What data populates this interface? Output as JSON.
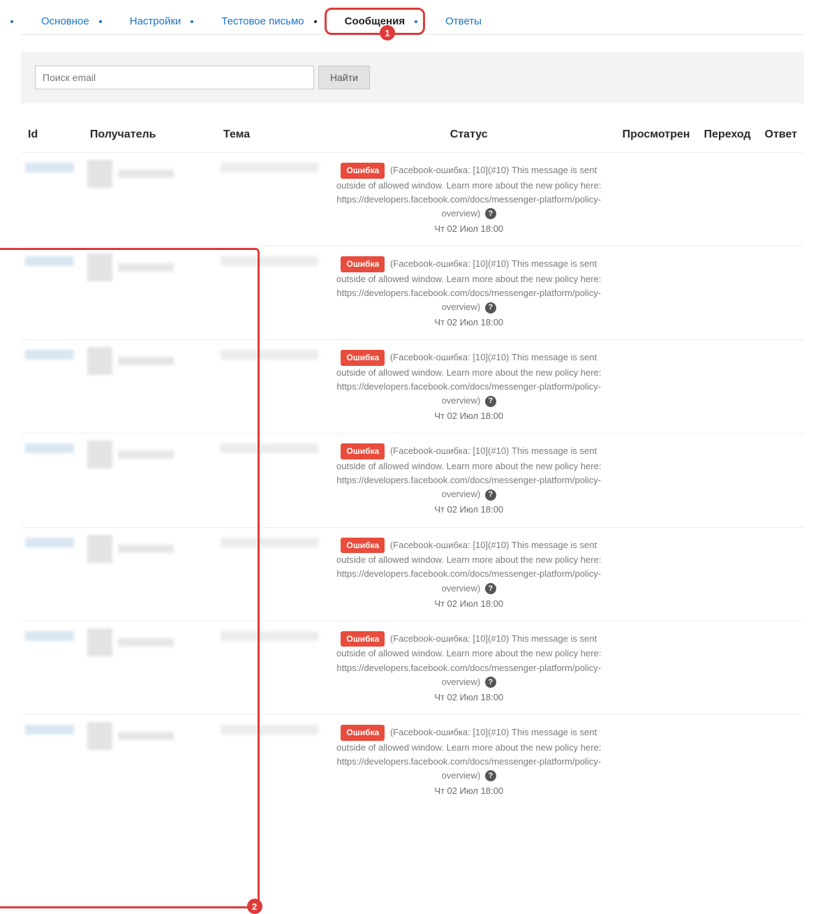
{
  "tabs": [
    {
      "label": "Основное"
    },
    {
      "label": "Настройки"
    },
    {
      "label": "Тестовое письмо"
    },
    {
      "label": "Сообщения",
      "active": true
    },
    {
      "label": "Ответы"
    }
  ],
  "callouts": {
    "one": "1",
    "two": "2"
  },
  "search": {
    "placeholder": "Поиск email",
    "button": "Найти"
  },
  "columns": {
    "id": "Id",
    "recipient": "Получатель",
    "subject": "Тема",
    "status": "Статус",
    "viewed": "Просмотрен",
    "click": "Переход",
    "answer": "Ответ"
  },
  "status_block": {
    "badge": "Ошибка",
    "text": "(Facebook-ошибка: [10](#10) This message is sent outside of allowed window. Learn more about the new policy here: https://developers.facebook.com/docs/messenger-platform/policy-overview)",
    "timestamp": "Чт 02 Июл 18:00"
  },
  "row_count": 7
}
